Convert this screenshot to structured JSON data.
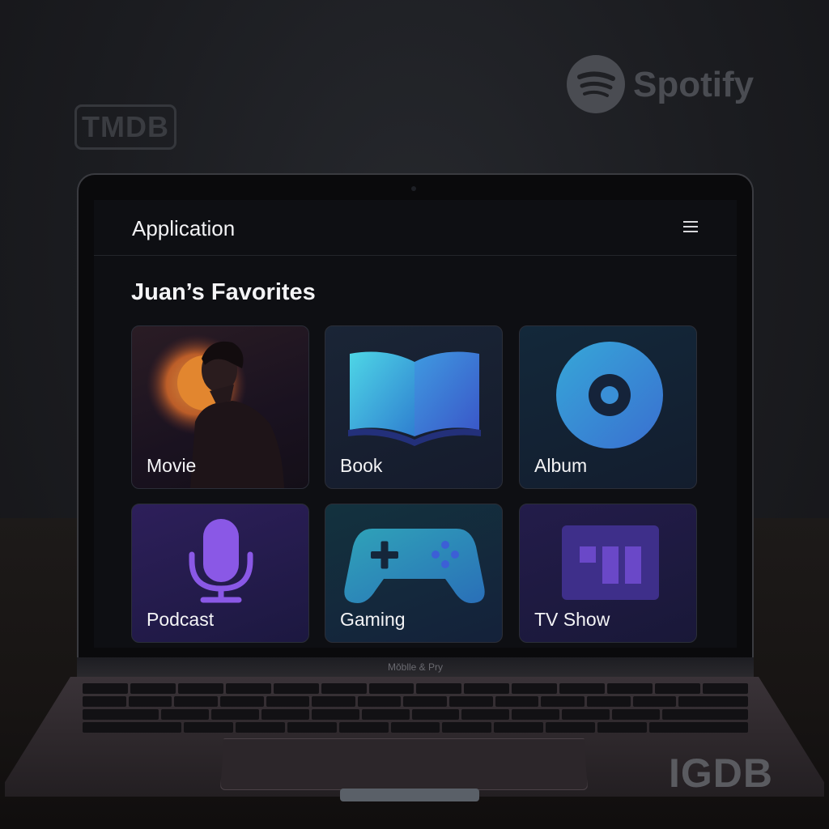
{
  "background_logos": {
    "tmdb": "TMDB",
    "spotify": "Spotify",
    "igdb": "IGDB"
  },
  "laptop": {
    "brand_label": "Mŏblle & Pry"
  },
  "app": {
    "title": "Application",
    "menu_icon": "hamburger-menu-icon"
  },
  "favorites": {
    "heading": "Juan’s Favorites",
    "cards": [
      {
        "label": "Movie",
        "icon": "movie-poster-image"
      },
      {
        "label": "Book",
        "icon": "open-book-icon"
      },
      {
        "label": "Album",
        "icon": "vinyl-disc-icon"
      },
      {
        "label": "Podcast",
        "icon": "microphone-icon"
      },
      {
        "label": "Gaming",
        "icon": "gamepad-icon"
      },
      {
        "label": "TV Show",
        "icon": "tv-show-bars-icon"
      }
    ]
  },
  "colors": {
    "background": "#1b1c20",
    "screen": "#0e0f13",
    "card_border": "#2b2e38",
    "accent_purple": "#8b5cf6",
    "accent_cyan": "#38bdf8"
  }
}
